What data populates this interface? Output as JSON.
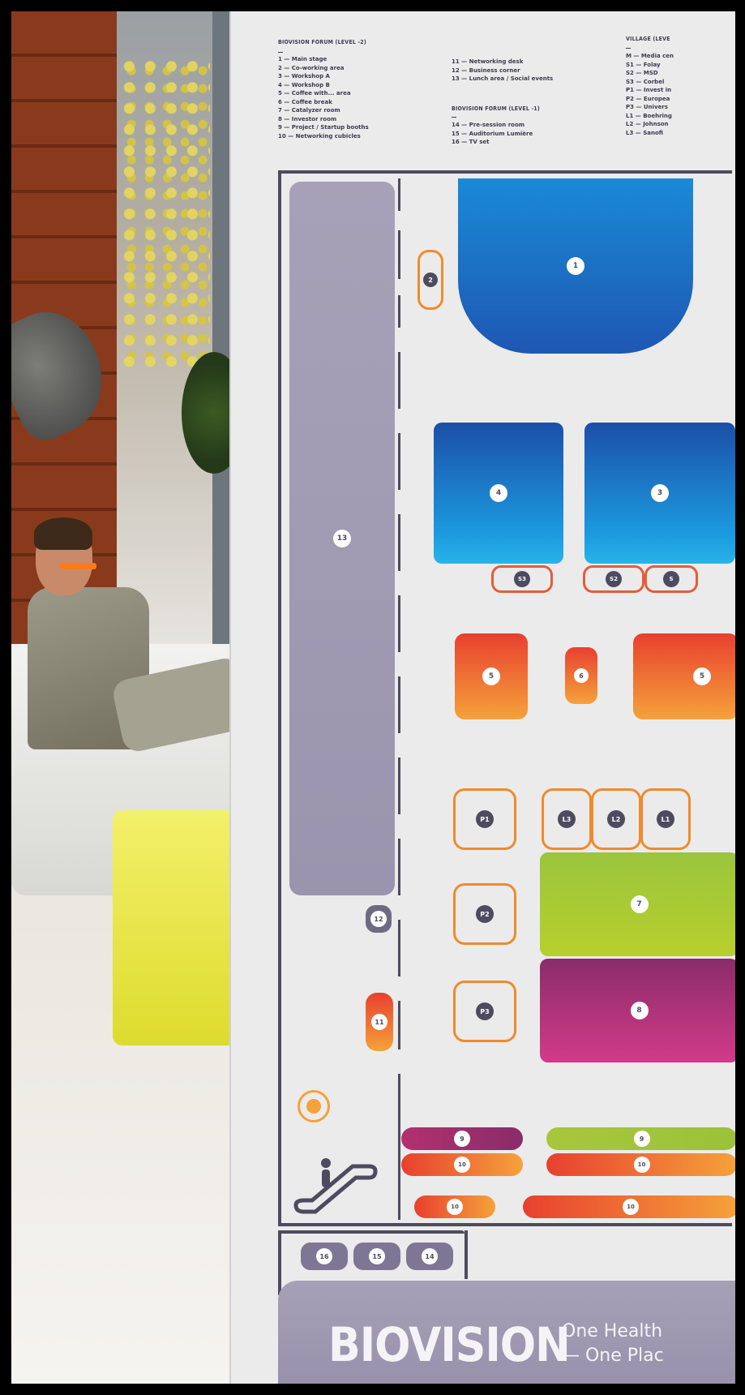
{
  "legend": {
    "forum_level_2": {
      "heading": "BIOVISION FORUM (LEVEL -2)",
      "items": [
        "1 — Main stage",
        "2 — Co-working area",
        "3 — Workshop A",
        "4 — Workshop B",
        "5 — Coffee with... area",
        "6 — Coffee break",
        "7 — Catalyzer room",
        "8 — Investor room",
        "9 — Project / Startup booths",
        "10 — Networking cubicles"
      ],
      "items_cont": [
        "11 — Networking desk",
        "12 — Business corner",
        "13 — Lunch area / Social events"
      ]
    },
    "forum_level_1": {
      "heading": "BIOVISION FORUM (LEVEL -1)",
      "items": [
        "14 — Pre-session room",
        "15 — Auditorium Lumière",
        "16 — TV set"
      ]
    },
    "village": {
      "heading": "VILLAGE (LEVE",
      "items": [
        "M — Media cen",
        "S1 — Folay",
        "S2 — MSD",
        "S3 — Corbel",
        "P1 — Invest in",
        "P2 — Europea",
        "P3 — Univers",
        "L1 — Boehring",
        "L2 — Johnson",
        "L3 — Sanofi"
      ]
    }
  },
  "map": {
    "labels": {
      "r1": "1",
      "r2": "2",
      "r3": "3",
      "r4": "4",
      "r5a": "5",
      "r5b": "5",
      "r6": "6",
      "r7": "7",
      "r8": "8",
      "r9a": "9",
      "r9b": "9",
      "r10a": "10",
      "r10b": "10",
      "r10c": "10",
      "r10d": "10",
      "r11": "11",
      "r12": "12",
      "r13": "13",
      "r14": "14",
      "r15": "15",
      "r16": "16",
      "s1": "S",
      "s2": "S2",
      "s3": "S3",
      "p1": "P1",
      "p2": "P2",
      "p3": "P3",
      "l1": "L1",
      "l2": "L2",
      "l3": "L3"
    },
    "colors": {
      "blue": "#1f6fc4",
      "orange": "#f08a2c",
      "green": "#9bc23a",
      "magenta": "#b3306f",
      "lavender": "#a59fb8",
      "wall": "#4e4a5f"
    }
  },
  "brand": {
    "name": "BIOVISION",
    "tagline_1": "One Health",
    "tagline_2": "— One Plac"
  }
}
